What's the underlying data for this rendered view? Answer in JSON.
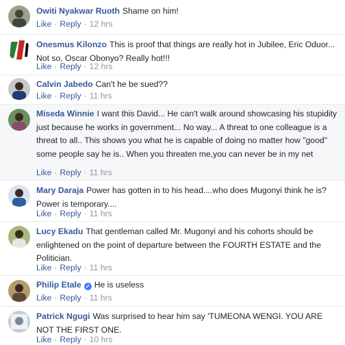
{
  "comments": [
    {
      "name": "Owiti Nyakwar Ruoth",
      "text": "Shame on him!",
      "like": "Like",
      "reply": "Reply",
      "time": "12 hrs"
    },
    {
      "name": "Onesmus Kilonzo",
      "text": "This is proof that things are really hot in Jubilee, Eric Oduor... Not so, Oscar Obonyo? Really hot!!!",
      "like": "Like",
      "reply": "Reply",
      "time": "12 hrs"
    },
    {
      "name": "Calvin Jabedo",
      "text": "Can't he be sued??",
      "like": "Like",
      "reply": "Reply",
      "time": "11 hrs"
    },
    {
      "name": "Miseda Winnie",
      "text": "I want this David... He can't walk around showcasing his stupidity just because he works in government... No way... A threat to one colleague is a threat to all.. This shows you what he is capable of doing no matter how \"good\" some people say he is.. When you threaten me,you can never be in my net",
      "like": "Like",
      "reply": "Reply",
      "time": "11 hrs"
    },
    {
      "name": "Mary Daraja",
      "text": "Power has gotten in to his head....who does Mugonyi think he is? Power is temporary....",
      "like": "Like",
      "reply": "Reply",
      "time": "11 hrs"
    },
    {
      "name": "Lucy Ekadu",
      "text": "That gentleman called Mr. Mugonyi and his cohorts should be enlightened on the point of departure between the FOURTH ESTATE and the Politician.",
      "like": "Like",
      "reply": "Reply",
      "time": "11 hrs"
    },
    {
      "name": "Philip Etale",
      "text": "He is useless",
      "like": "Like",
      "reply": "Reply",
      "time": "11 hrs"
    },
    {
      "name": "Patrick Ngugi",
      "text": "Was surprised to hear him say 'TUMEONA WENGI. YOU ARE NOT THE FIRST ONE.",
      "like": "Like",
      "reply": "Reply",
      "time": "10 hrs"
    }
  ],
  "colors": {
    "name_link": "#365899",
    "timestamp": "#90949c",
    "text": "#1d2129",
    "verified_badge": "#4080ff"
  },
  "verified_icon": "check-mark-icon"
}
